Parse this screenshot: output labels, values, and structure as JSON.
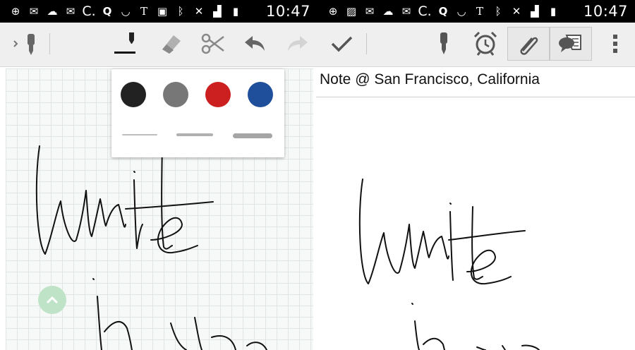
{
  "status_bar": {
    "time": "10:47",
    "icons": [
      "add-icon",
      "gmail-icon",
      "cloud-upload-icon",
      "gmail-icon",
      "c-icon",
      "q-icon",
      "nfc-icon",
      "nyt-icon",
      "app-icon",
      "bluetooth-icon",
      "mute-icon",
      "signal-icon",
      "battery-icon"
    ],
    "icons_right": [
      "add-icon",
      "image-icon",
      "gmail-icon",
      "cloud-upload-icon",
      "gmail-icon",
      "c-icon",
      "q-icon",
      "nfc-icon",
      "nyt-icon",
      "bluetooth-icon",
      "mute-icon",
      "signal-icon",
      "battery-icon"
    ]
  },
  "toolbar": {
    "tools": [
      "pen-icon",
      "eraser-icon",
      "scissors-icon",
      "undo-icon",
      "redo-icon",
      "check-icon"
    ],
    "actions": [
      "pen-icon",
      "alarm-icon",
      "attach-icon",
      "comment-icon",
      "overflow-menu-icon"
    ]
  },
  "palette": {
    "colors": [
      "#222222",
      "#777777",
      "#cc1f1f",
      "#1f4f9a"
    ],
    "stroke_widths": [
      "thin",
      "medium",
      "thick"
    ]
  },
  "note": {
    "title": "Note @ San Francisco, California"
  },
  "colors": {
    "toolbar_bg": "#efefef",
    "grid_bg": "#f7f9f8",
    "fab": "#bfe3c6"
  }
}
